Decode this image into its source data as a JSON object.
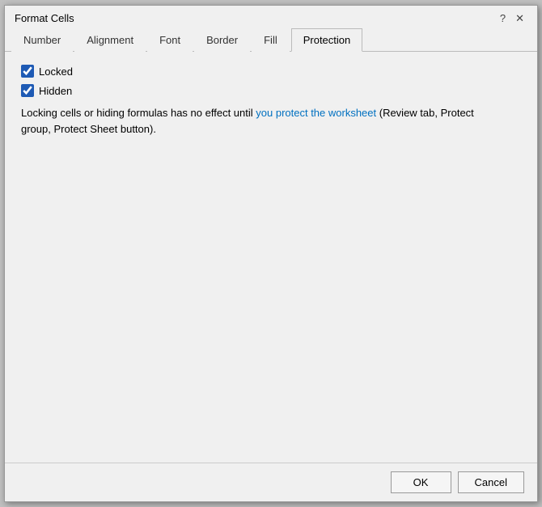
{
  "dialog": {
    "title": "Format Cells",
    "help_icon": "?",
    "close_icon": "✕"
  },
  "tabs": [
    {
      "label": "Number",
      "active": false
    },
    {
      "label": "Alignment",
      "active": false
    },
    {
      "label": "Font",
      "active": false
    },
    {
      "label": "Border",
      "active": false
    },
    {
      "label": "Fill",
      "active": false
    },
    {
      "label": "Protection",
      "active": true
    }
  ],
  "protection": {
    "locked_label": "Locked",
    "hidden_label": "Hidden",
    "info_text_before": "Locking cells or hiding formulas has no effect until ",
    "info_text_highlight": "you protect the worksheet",
    "info_text_after": " (Review tab, Protect group, Protect Sheet button).",
    "locked_checked": true,
    "hidden_checked": true
  },
  "footer": {
    "ok_label": "OK",
    "cancel_label": "Cancel"
  }
}
